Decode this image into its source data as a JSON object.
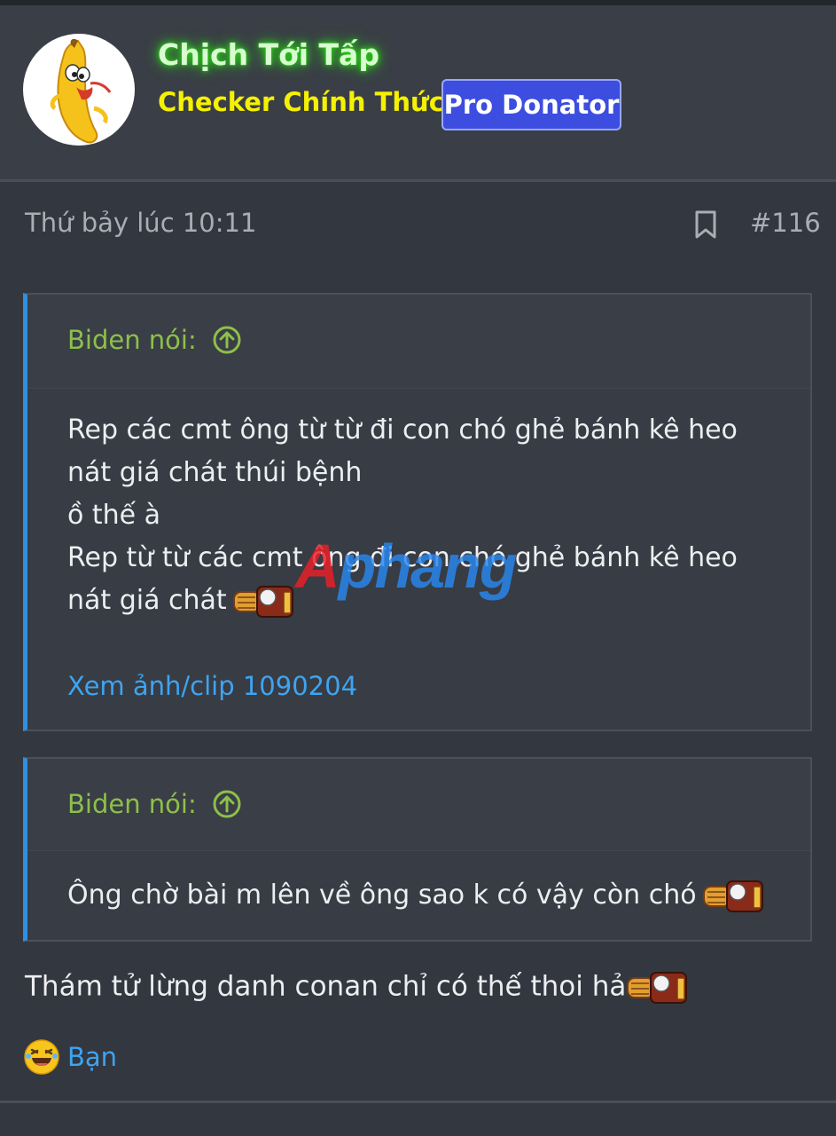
{
  "user": {
    "username": "Chịch Tới Tấp",
    "title": "Checker Chính Thức",
    "badge": "Pro Donator",
    "username_color": "#d8fcd0",
    "username_glow": "#2cd51a",
    "title_color": "#f6f100",
    "badge_bg": "#3c4de0"
  },
  "post": {
    "timestamp": "Thứ bảy lúc 10:11",
    "number": "#116",
    "bookmark_icon": "bookmark-icon",
    "body": "Thám tử lừng danh conan chỉ có thế thoi hả"
  },
  "quotes": [
    {
      "author": "Biden nói:",
      "lines": [
        "Rep các cmt ông từ từ đi con chó ghẻ bánh kê heo",
        "nát giá chát thúi bệnh",
        "ồ thế à",
        "Rep từ từ các cmt ông đi con chó ghẻ bánh kê heo",
        "nát giá chát"
      ],
      "link": "Xem ảnh/clip 1090204"
    },
    {
      "author": "Biden nói:",
      "lines": [
        "Ông chờ bài m lên về ông sao k có vậy còn chó"
      ]
    }
  ],
  "watermark": {
    "first": "A",
    "rest": "phang"
  },
  "reaction": {
    "icon": "laughing-emoji-icon",
    "label": "Bạn"
  },
  "colors": {
    "background": "#33373f",
    "quote_border": "#2f8fe0",
    "quote_author": "#8dc04a",
    "link": "#3ea4f0"
  }
}
